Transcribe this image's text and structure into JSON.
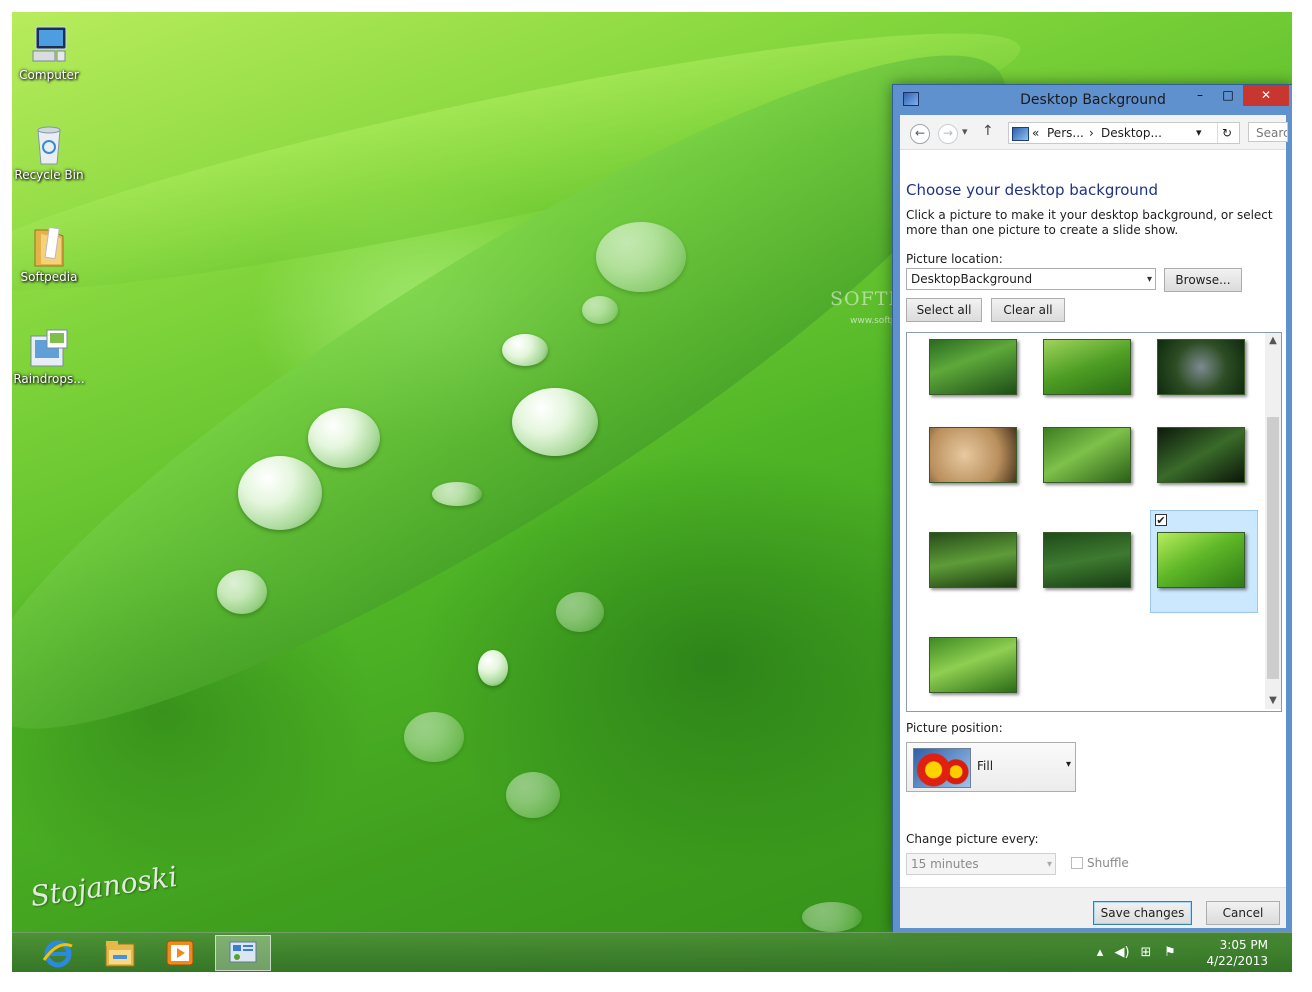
{
  "desktop": {
    "icons": [
      {
        "label": "Computer"
      },
      {
        "label": "Recycle Bin"
      },
      {
        "label": "Softpedia"
      },
      {
        "label": "Raindrops..."
      }
    ],
    "signature": "Stojanoski",
    "watermark": "SOFTPEDIA",
    "watermark_url": "www.softpedia.com"
  },
  "taskbar": {
    "apps": [
      {
        "name": "internet-explorer-icon"
      },
      {
        "name": "file-explorer-icon"
      },
      {
        "name": "media-player-icon"
      },
      {
        "name": "control-panel-icon",
        "active": true
      }
    ],
    "tray_icons": [
      "chevron-up-icon",
      "volume-icon",
      "network-icon",
      "action-center-icon"
    ],
    "time": "3:05 PM",
    "date": "4/22/2013"
  },
  "window": {
    "title": "Desktop Background",
    "controls": {
      "minimize": "–",
      "maximize": "□",
      "close": "✕"
    },
    "nav": {
      "back": "←",
      "forward": "→",
      "recent": "▾",
      "up": "↑",
      "breadcrumb_prefix": "«",
      "breadcrumb_1": "Pers...",
      "separator": "›",
      "breadcrumb_2": "Desktop...",
      "dropdown": "▾",
      "refresh": "↻",
      "search_placeholder": "Search"
    },
    "heading": "Choose your desktop background",
    "description": "Click a picture to make it your desktop background, or select more than one picture to create a slide show.",
    "picture_location": {
      "label": "Picture location:",
      "value": "DesktopBackground",
      "browse": "Browse..."
    },
    "select_all": "Select all",
    "clear_all": "Clear all",
    "thumbnails": [
      {
        "id": 1,
        "selected": false
      },
      {
        "id": 2,
        "selected": false
      },
      {
        "id": 3,
        "selected": false
      },
      {
        "id": 4,
        "selected": false
      },
      {
        "id": 5,
        "selected": false
      },
      {
        "id": 6,
        "selected": false
      },
      {
        "id": 7,
        "selected": false
      },
      {
        "id": 8,
        "selected": false
      },
      {
        "id": 9,
        "selected": true,
        "check": "✔"
      },
      {
        "id": 10,
        "selected": false
      }
    ],
    "picture_position": {
      "label": "Picture position:",
      "value": "Fill"
    },
    "change_picture": {
      "label": "Change picture every:",
      "value": "15 minutes",
      "shuffle_label": "Shuffle"
    },
    "save_button": "Save changes",
    "cancel_button": "Cancel"
  }
}
